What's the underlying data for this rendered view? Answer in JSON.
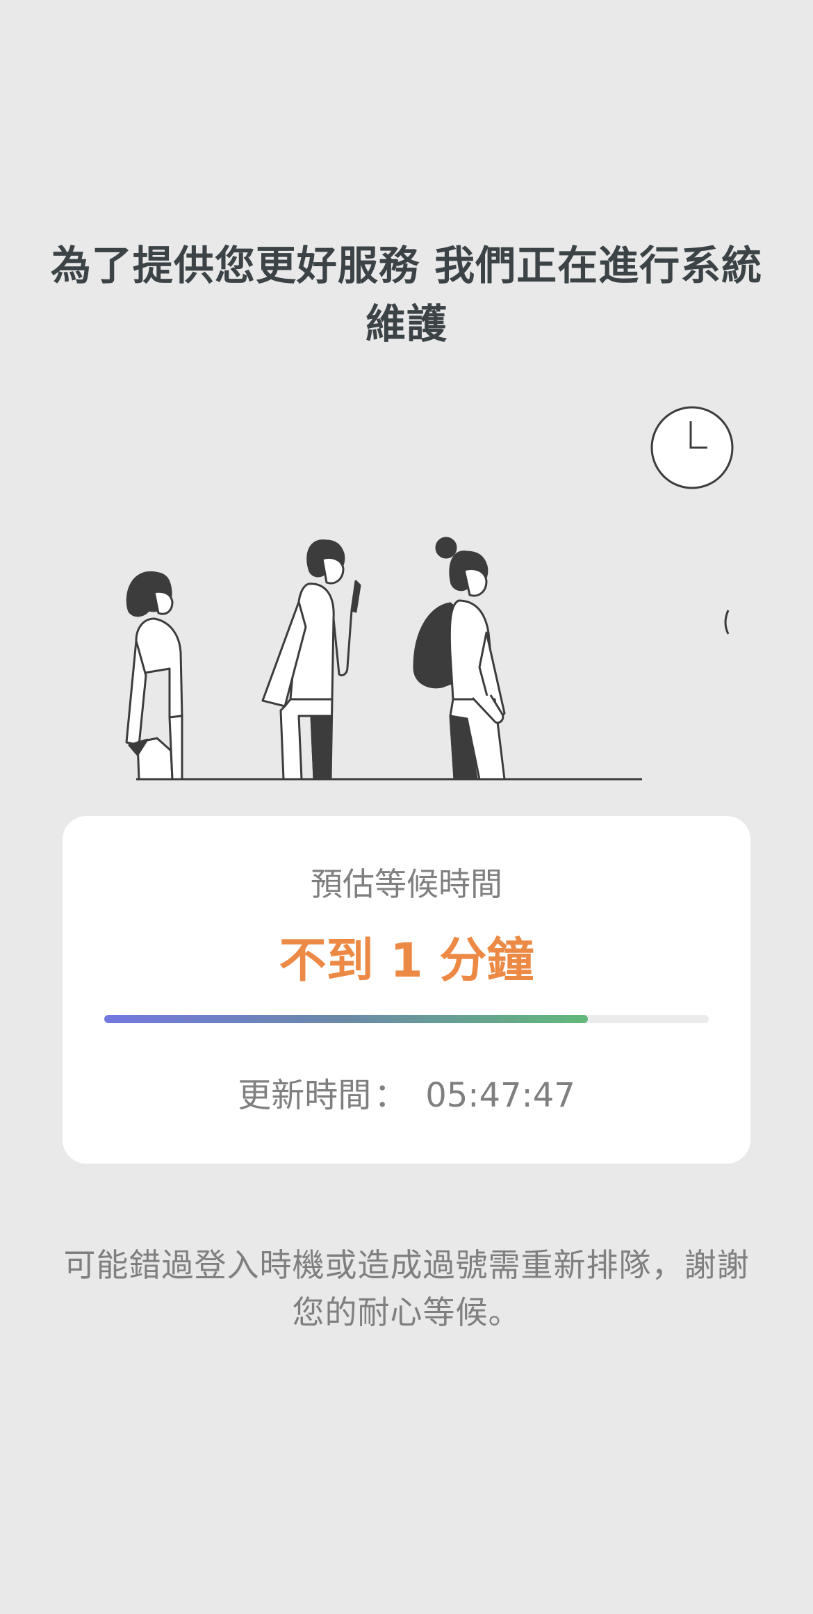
{
  "title": "為了提供您更好服務 我們正在進行系統維護",
  "card": {
    "wait_label": "預估等候時間",
    "wait_value": "不到 1 分鐘",
    "progress": 0.8,
    "update_label": "更新時間",
    "update_colon": "：",
    "update_time": "05:47:47"
  },
  "notice": "可能錯過登入時機或造成過號需重新排隊，謝謝您的耐心等候。",
  "colors": {
    "background": "#e9e9e9",
    "title": "#3c4347",
    "accent_orange": "#ec8a45",
    "progress_start": "#7378e0",
    "progress_end": "#62b87a"
  },
  "icons": [
    "clock-icon",
    "people-queue-illustration"
  ]
}
